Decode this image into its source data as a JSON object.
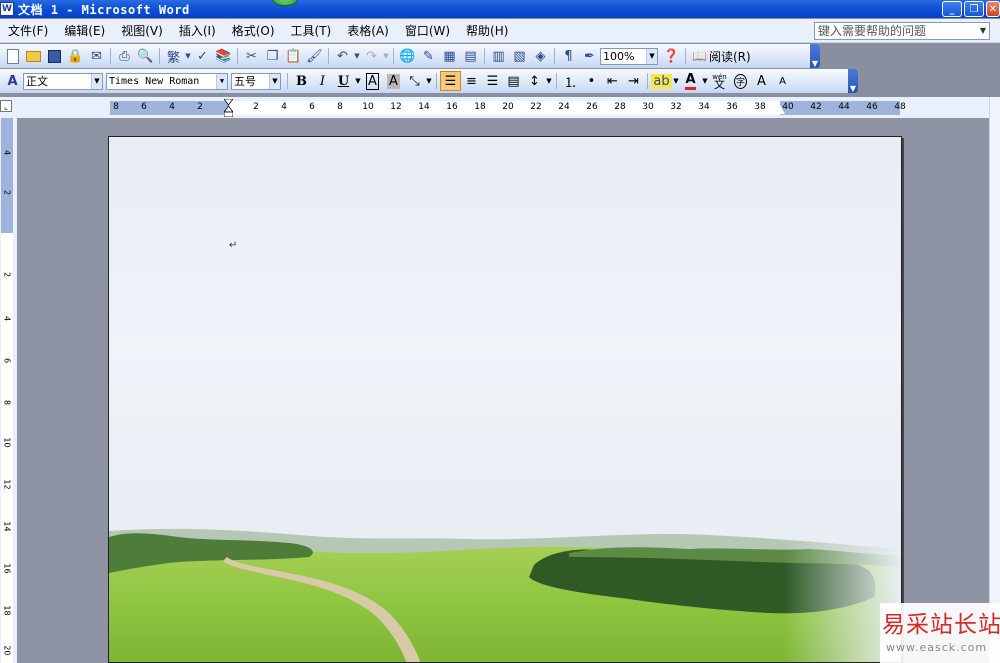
{
  "window": {
    "app_icon_letter": "W",
    "title": "文档 1 - Microsoft Word",
    "minimize": "_",
    "restore": "❐",
    "close": "✕"
  },
  "menu": {
    "items": [
      "文件(F)",
      "编辑(E)",
      "视图(V)",
      "插入(I)",
      "格式(O)",
      "工具(T)",
      "表格(A)",
      "窗口(W)",
      "帮助(H)"
    ],
    "help_placeholder": "键入需要帮助的问题"
  },
  "standard_toolbar": {
    "zoom": "100%",
    "reading_label": "阅读(R)"
  },
  "format_toolbar": {
    "style": "正文",
    "font": "Times New Roman",
    "size": "五号",
    "bold": "B",
    "italic": "I",
    "underline": "U",
    "style_icon_text": "A",
    "border_a": "A",
    "shade_a": "A",
    "font_color_a": "A",
    "pinyin": "wén",
    "grow": "A",
    "shrink": "A"
  },
  "ruler": {
    "left_ticks": [
      "8",
      "6",
      "4",
      "2"
    ],
    "right_ticks": [
      "2",
      "4",
      "6",
      "8",
      "10",
      "12",
      "14",
      "16",
      "18",
      "20",
      "22",
      "24",
      "26",
      "28",
      "30",
      "32",
      "34",
      "36",
      "38",
      "40",
      "42",
      "44",
      "46",
      "48"
    ],
    "vertical_ticks": [
      "4",
      "2",
      "2",
      "4",
      "6",
      "8",
      "10",
      "12",
      "14",
      "16",
      "18",
      "20"
    ]
  },
  "document": {
    "paragraph_mark": "↵"
  },
  "watermark": {
    "chinese": "易采站长站",
    "url": "www.easck.com"
  },
  "colors": {
    "titlebar": "#0a4fd6",
    "menubar": "#eaf0fb",
    "workarea": "#8f94a5",
    "grass": "#8cc63f",
    "watermark_red": "#d42a2a"
  }
}
